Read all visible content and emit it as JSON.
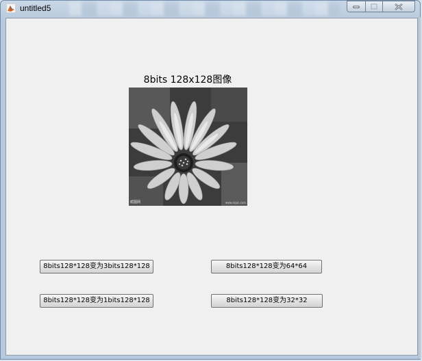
{
  "window": {
    "title": "untitled5",
    "icon": "matlab-figure-icon",
    "controls": {
      "minimize_icon": "minimize-icon",
      "maximize_icon": "maximize-icon",
      "close_icon": "close-icon"
    }
  },
  "figure": {
    "image_title": "8bits 128x128图像",
    "image": {
      "subject": "grayscale flower",
      "watermark_left": "昵图网",
      "watermark_right": "www.nipic.com"
    }
  },
  "buttons": {
    "to_3bits": "8bits128*128变为3bits128*128",
    "to_64": "8bits128*128变为64*64",
    "to_1bits": "8bits128*128变为1bits128*128",
    "to_32": "8bits128*128变为32*32"
  },
  "colors": {
    "client_bg": "#f0f0f0",
    "titlebar": "#c9d8e8"
  }
}
